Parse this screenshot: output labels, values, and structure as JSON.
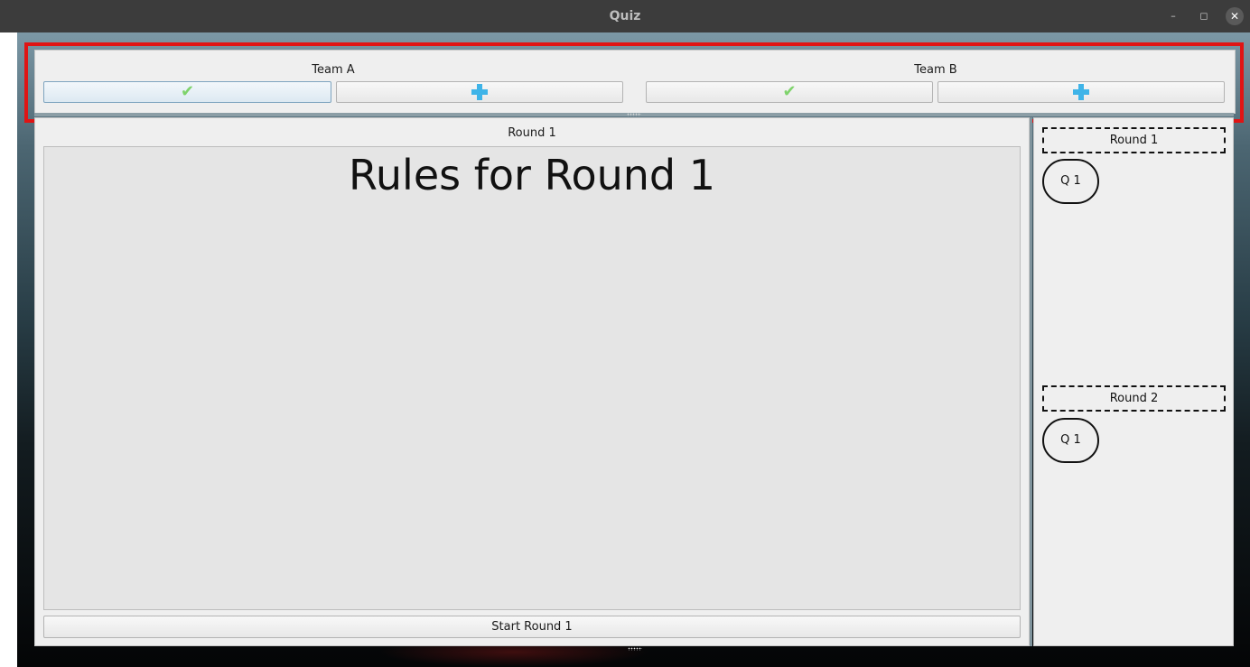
{
  "window": {
    "title": "Quiz",
    "controls": {
      "minimize": "–",
      "maximize": "◻",
      "close": "✕"
    }
  },
  "teams": [
    {
      "name": "Team A",
      "buttons": [
        {
          "icon": "check-icon",
          "color": "#7fd36c"
        },
        {
          "icon": "plus-icon",
          "color": "#3fb4e8"
        }
      ]
    },
    {
      "name": "Team B",
      "buttons": [
        {
          "icon": "check-icon",
          "color": "#7fd36c"
        },
        {
          "icon": "plus-icon",
          "color": "#3fb4e8"
        }
      ]
    }
  ],
  "icons": {
    "check": "✔"
  },
  "main": {
    "round_heading": "Round 1",
    "rules_title": "Rules for Round 1",
    "start_button": "Start Round 1"
  },
  "sidebar": {
    "rounds": [
      {
        "label": "Round 1",
        "questions": [
          {
            "label": "Q 1"
          }
        ]
      },
      {
        "label": "Round 2",
        "questions": [
          {
            "label": "Q 1"
          }
        ]
      }
    ]
  },
  "highlight": {
    "color": "#e01414"
  }
}
